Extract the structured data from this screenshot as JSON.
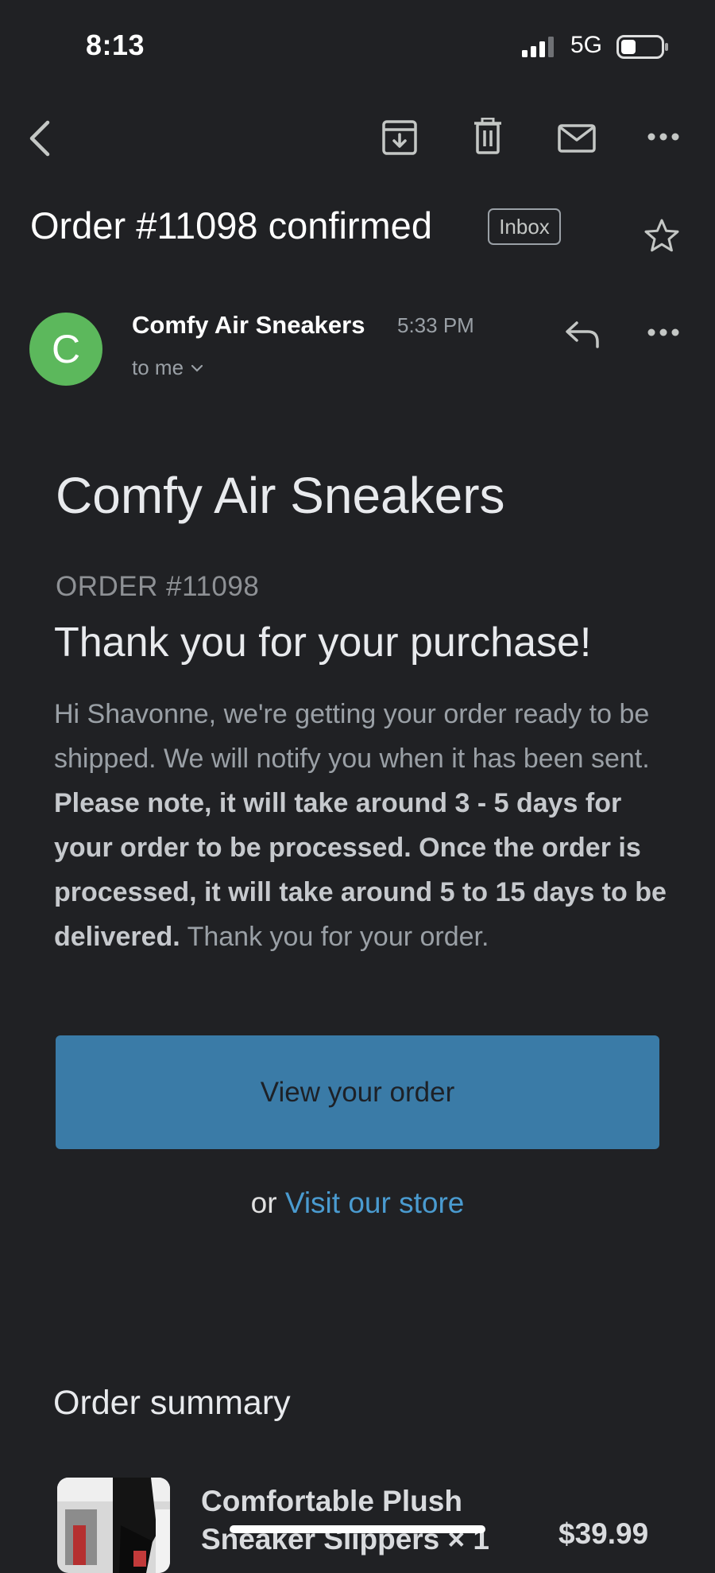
{
  "status_bar": {
    "time": "8:13",
    "network": "5G"
  },
  "toolbar": {
    "back_icon": "chevron-left-icon",
    "archive_icon": "archive-icon",
    "delete_icon": "trash-icon",
    "mark_unread_icon": "mail-icon",
    "more_icon": "more-horizontal-icon"
  },
  "email": {
    "subject": "Order #11098 confirmed",
    "label": "Inbox",
    "sender": {
      "avatar_letter": "C",
      "name": "Comfy Air Sneakers",
      "time": "5:33 PM",
      "recipient": "to me"
    }
  },
  "body": {
    "store_name": "Comfy Air Sneakers",
    "order_label": "ORDER #11098",
    "heading": "Thank you for your purchase!",
    "message_intro": "Hi Shavonne, we're getting your order ready to be shipped. We will notify you when it has been sent.",
    "message_bold": "Please note, it will take around 3 - 5 days for your order to be processed. Once the order is processed, it will take around 5 to 15 days to be delivered.",
    "message_outro": "Thank you for your order.",
    "view_order_label": "View your order",
    "or_text": "or",
    "visit_store_label": "Visit our store",
    "summary_title": "Order summary",
    "items": [
      {
        "name": "Comfortable Plush Sneaker Slippers × 1",
        "price": "$39.99"
      }
    ]
  },
  "colors": {
    "background": "#202124",
    "avatar": "#5cb85c",
    "button": "#3a7ba7",
    "link": "#4a9bd0"
  }
}
